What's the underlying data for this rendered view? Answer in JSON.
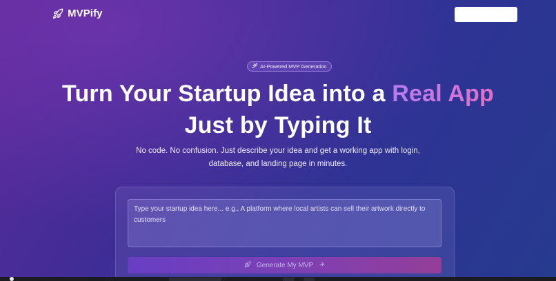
{
  "app": {
    "brand_name": "MVPify",
    "brand_icon": "rocket-icon",
    "accent_color": "#c77ee8"
  },
  "nav": {
    "cta_label": ""
  },
  "hero": {
    "badge_icon": "sparkles-icon",
    "badge_text": "AI-Powered MVP Generation",
    "headline_part1": "Turn Your Startup Idea into a ",
    "headline_accent": "Real App",
    "headline_line2": "Just by Typing It",
    "subtitle_line1": "No code. No confusion. Just describe your idea and get a working app with login,",
    "subtitle_line2": "database, and landing page in minutes."
  },
  "form": {
    "idea_value": "",
    "idea_placeholder": "Type your startup idea here... e.g., A platform where local artists can sell their artwork directly to customers",
    "generate_icon": "rocket-icon",
    "generate_label": "Generate My MVP",
    "generate_arrow_icon": "arrow-right-icon"
  }
}
